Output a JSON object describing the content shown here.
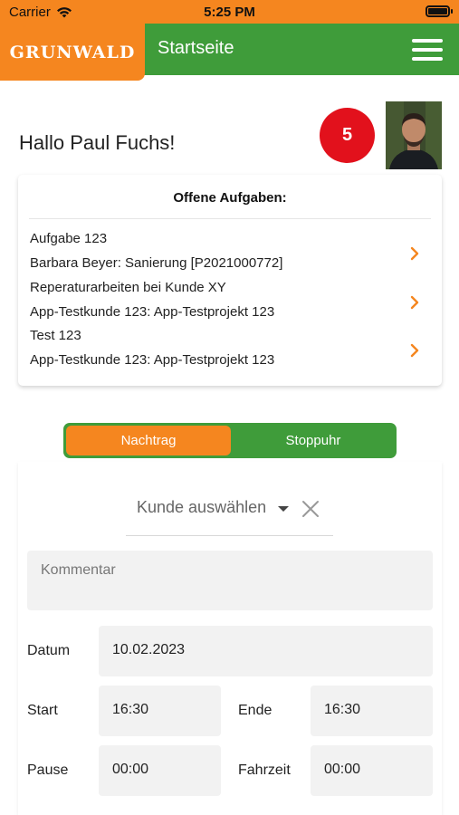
{
  "status_bar": {
    "carrier": "Carrier",
    "time": "5:25 PM"
  },
  "header": {
    "logo": "GRUNWALD",
    "title": "Startseite"
  },
  "greeting": "Hallo Paul Fuchs!",
  "badge_count": "5",
  "tasks": {
    "title": "Offene Aufgaben:",
    "items": [
      {
        "line1": "Aufgabe 123",
        "line2": "Barbara Beyer: Sanierung [P2021000772]"
      },
      {
        "line1": "Reperaturarbeiten bei Kunde XY",
        "line2": "App-Testkunde 123: App-Testprojekt 123"
      },
      {
        "line1": "Test 123",
        "line2": "App-Testkunde 123: App-Testprojekt 123"
      }
    ]
  },
  "segment": {
    "active": "Nachtrag",
    "inactive": "Stoppuhr"
  },
  "form": {
    "customer_placeholder": "Kunde auswählen",
    "comment_placeholder": "Kommentar",
    "date_label": "Datum",
    "date_value": "10.02.2023",
    "start_label": "Start",
    "start_value": "16:30",
    "end_label": "Ende",
    "end_value": "16:30",
    "pause_label": "Pause",
    "pause_value": "00:00",
    "travel_label": "Fahrzeit",
    "travel_value": "00:00"
  },
  "colors": {
    "orange": "#f5861f",
    "green": "#3f9c3a",
    "badge_red": "#e2111c"
  },
  "icons": [
    "wifi-icon",
    "battery-icon",
    "menu-icon",
    "chevron-right-icon",
    "caret-down-icon",
    "close-icon"
  ]
}
